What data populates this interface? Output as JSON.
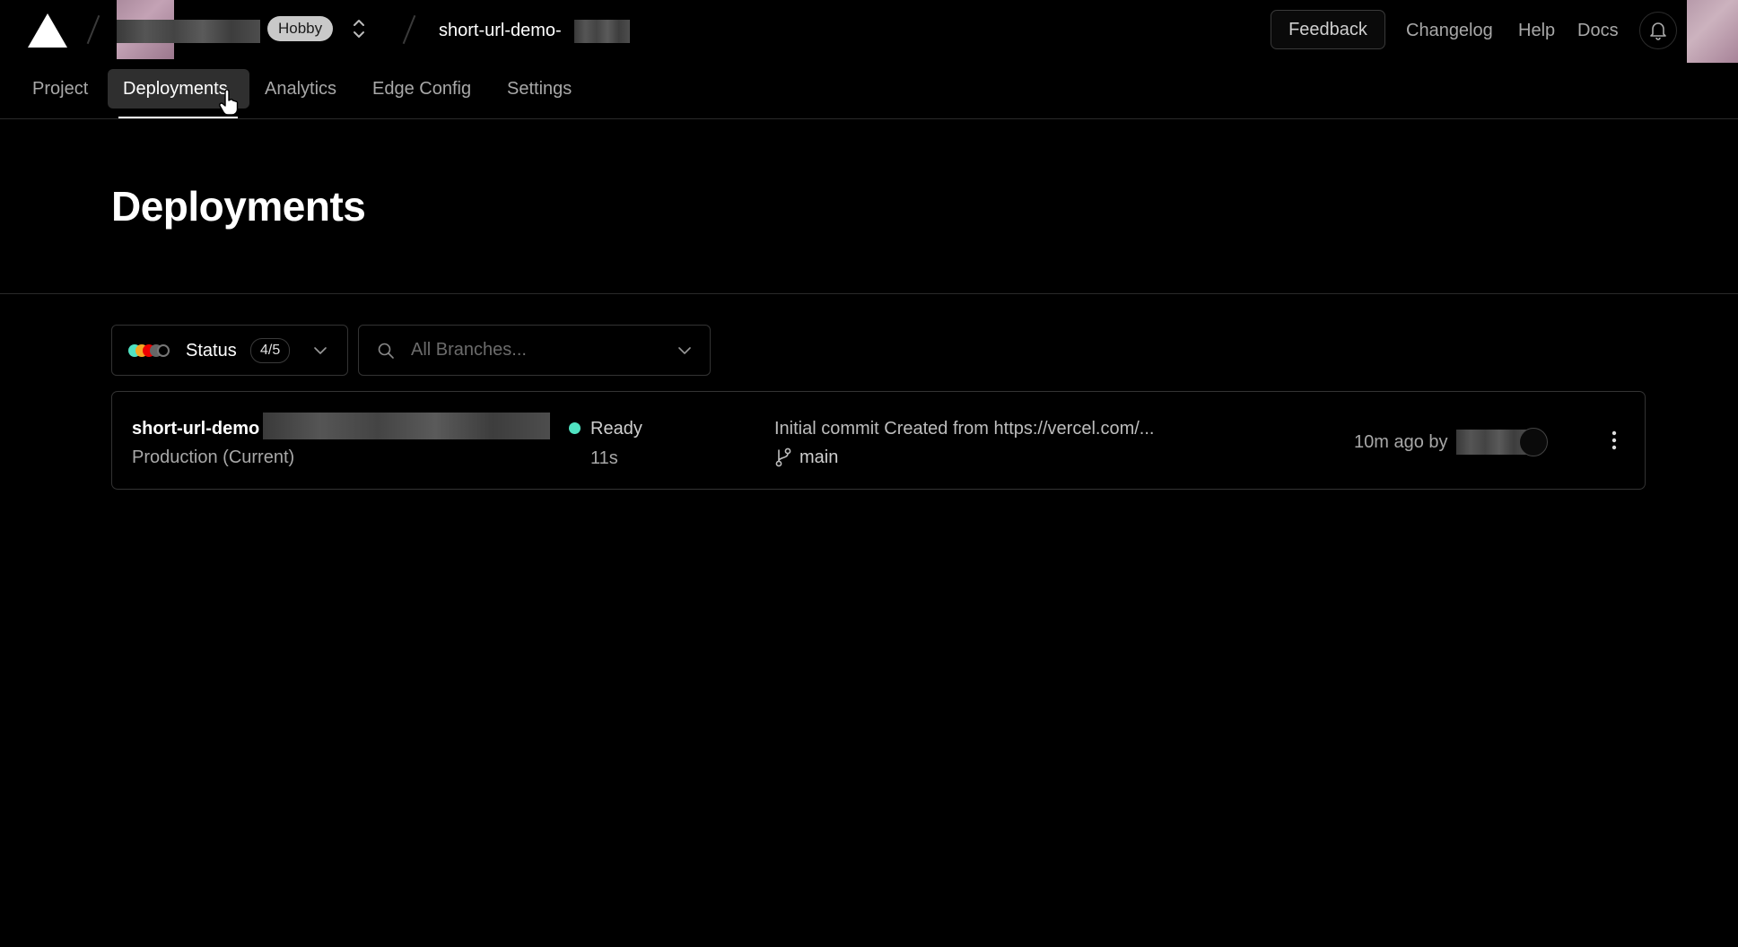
{
  "header": {
    "team_badge": "Hobby",
    "project_name": "short-url-demo-",
    "feedback_label": "Feedback",
    "links": [
      "Changelog",
      "Help",
      "Docs"
    ]
  },
  "tabs": [
    {
      "label": "Project",
      "active": false
    },
    {
      "label": "Deployments",
      "active": true
    },
    {
      "label": "Analytics",
      "active": false
    },
    {
      "label": "Edge Config",
      "active": false
    },
    {
      "label": "Settings",
      "active": false
    }
  ],
  "page": {
    "title": "Deployments"
  },
  "filters": {
    "status_label": "Status",
    "status_count": "4/5",
    "status_colors": [
      "#50e3c2",
      "#f5a623",
      "#ee0000",
      "#666666",
      "#888888"
    ],
    "branch_placeholder": "All Branches..."
  },
  "deployments": [
    {
      "name": "short-url-demo",
      "environment": "Production (Current)",
      "status": "Ready",
      "status_color": "#50e3c2",
      "duration": "11s",
      "commit_message": "Initial commit Created from https://vercel.com/...",
      "branch": "main",
      "time_ago": "10m ago by"
    }
  ],
  "icons": {
    "logo": "vercel-triangle-icon",
    "scope_switcher": "chevron-up-down-icon",
    "notifications": "bell-icon",
    "search": "search-icon",
    "dropdown": "chevron-down-icon",
    "branch": "git-branch-icon",
    "more": "more-vertical-icon"
  }
}
